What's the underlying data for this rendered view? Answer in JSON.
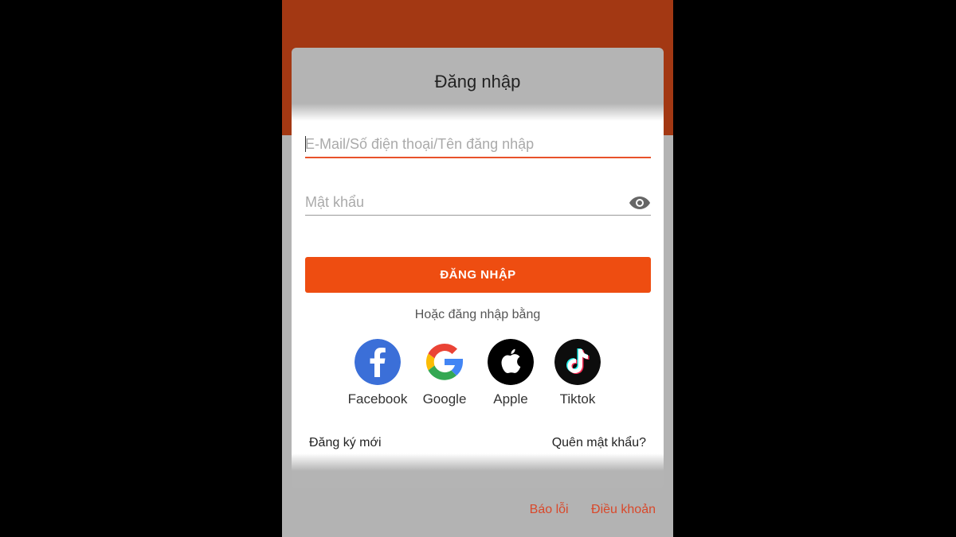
{
  "login": {
    "title": "Đăng nhập",
    "email_placeholder": "E-Mail/Số điện thoại/Tên đăng nhập",
    "email_value": "",
    "password_placeholder": "Mật khẩu",
    "password_value": "",
    "submit_label": "ĐĂNG NHẬP",
    "or_text": "Hoặc đăng nhập bằng",
    "socials": [
      {
        "label": "Facebook",
        "icon": "facebook-icon"
      },
      {
        "label": "Google",
        "icon": "google-icon"
      },
      {
        "label": "Apple",
        "icon": "apple-icon"
      },
      {
        "label": "Tiktok",
        "icon": "tiktok-icon"
      }
    ],
    "register_link": "Đăng ký mới",
    "forgot_link": "Quên mật khẩu?"
  },
  "footer": {
    "report_link": "Báo lỗi",
    "terms_link": "Điều khoản"
  },
  "colors": {
    "accent": "#ee4d11",
    "header": "#a33813",
    "link": "#d9482a"
  }
}
